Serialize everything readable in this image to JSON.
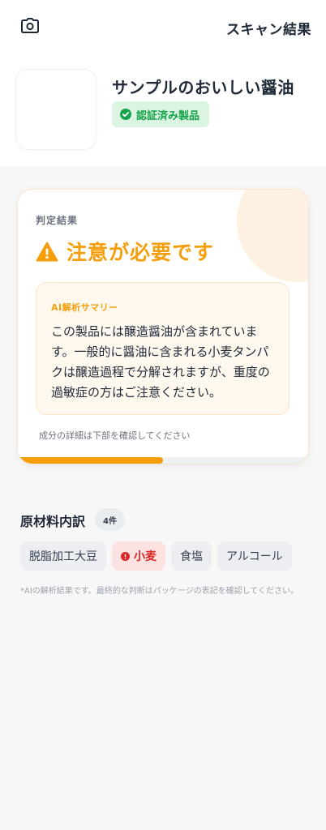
{
  "header": {
    "camera_icon": "camera-icon",
    "title": "スキャン結果"
  },
  "product": {
    "name": "サンプルのおいしい醤油",
    "badge": "認証済み製品",
    "badge_color": "#16a34a"
  },
  "result": {
    "label": "判定結果",
    "status": "注意が必要です",
    "status_icon": "warning-icon",
    "accent_color": "#f59e0b",
    "summary_title": "AI解析サマリー",
    "summary_body": "この製品には醸造醤油が含まれています。一般的に醤油に含まれる小麦タンパクは醸造過程で分解されますが、重度の過敏症の方はご注意ください。",
    "detail_note": "成分の詳細は下部を確認してください",
    "progress": 0.5
  },
  "ingredients": {
    "title": "原材料内訳",
    "count": "4件",
    "items": [
      {
        "label": "脱脂加工大豆",
        "alert": false
      },
      {
        "label": "小麦",
        "alert": true
      },
      {
        "label": "食塩",
        "alert": false
      },
      {
        "label": "アルコール",
        "alert": false
      }
    ],
    "alert_color": "#dc2626"
  },
  "disclaimer": "*AIの解析結果です。最終的な判断はパッケージの表記を確認してください。"
}
